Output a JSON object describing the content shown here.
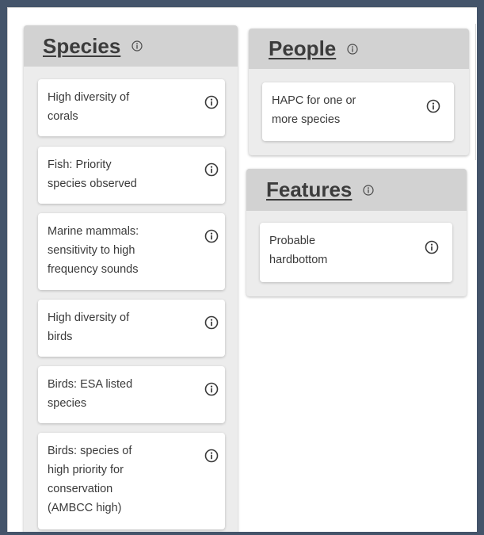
{
  "panels": {
    "species": {
      "title": "Species",
      "info_icon": "info-circle-icon",
      "cards": [
        {
          "label_lines": [
            "High diversity of",
            "corals"
          ]
        },
        {
          "label_lines": [
            "Fish: Priority",
            "species observed"
          ]
        },
        {
          "label_lines": [
            "Marine mammals:",
            "sensitivity to high",
            "frequency sounds"
          ]
        },
        {
          "label_lines": [
            "High diversity of",
            "birds"
          ]
        },
        {
          "label_lines": [
            "Birds: ESA listed",
            "species"
          ]
        },
        {
          "label_lines": [
            "Birds: species of",
            "high priority for",
            "conservation",
            "(AMBCC high)"
          ]
        }
      ]
    },
    "people": {
      "title": "People",
      "info_icon": "info-circle-icon",
      "cards": [
        {
          "label_lines": [
            "HAPC for one or",
            "more species"
          ]
        }
      ]
    },
    "features": {
      "title": "Features",
      "info_icon": "info-circle-icon",
      "cards": [
        {
          "label_lines": [
            "Probable",
            "hardbottom"
          ]
        }
      ]
    }
  },
  "colors": {
    "frame": "#44546a",
    "panel_header": "#d2d2d2",
    "panel_body": "#ececec",
    "card": "#ffffff",
    "text": "#3a3a3a"
  }
}
